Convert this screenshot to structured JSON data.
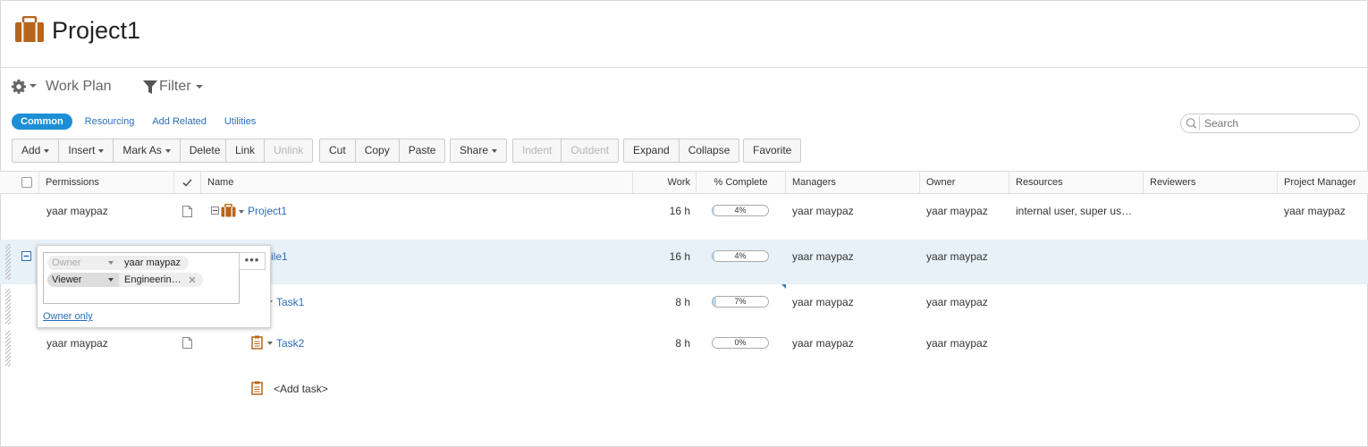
{
  "header": {
    "title": "Project1"
  },
  "workplan": {
    "title": "Work Plan",
    "filter_label": "Filter"
  },
  "tabs": [
    {
      "label": "Common",
      "active": true
    },
    {
      "label": "Resourcing"
    },
    {
      "label": "Add Related"
    },
    {
      "label": "Utilities"
    }
  ],
  "search": {
    "placeholder": "Search"
  },
  "toolbar": {
    "add": "Add",
    "insert": "Insert",
    "mark_as": "Mark As",
    "delete": "Delete",
    "link": "Link",
    "unlink": "Unlink",
    "cut": "Cut",
    "copy": "Copy",
    "paste": "Paste",
    "share": "Share",
    "indent": "Indent",
    "outdent": "Outdent",
    "expand": "Expand",
    "collapse": "Collapse",
    "favorite": "Favorite"
  },
  "columns": {
    "permissions": "Permissions",
    "name": "Name",
    "work": "Work",
    "pct": "% Complete",
    "managers": "Managers",
    "owner": "Owner",
    "resources": "Resources",
    "reviewers": "Reviewers",
    "project_manager": "Project Manager"
  },
  "rows": [
    {
      "permissions": "yaar maypaz",
      "name": "Project1",
      "work": "16 h",
      "pct": "4%",
      "pct_value": 4,
      "managers": "yaar maypaz",
      "owner": "yaar maypaz",
      "resources": "internal user, super us…",
      "project_manager": "yaar maypaz"
    },
    {
      "permissions": "",
      "name": "ile1",
      "work": "16 h",
      "pct": "4%",
      "pct_value": 4,
      "managers": "yaar maypaz",
      "owner": "yaar maypaz"
    },
    {
      "permissions": "",
      "name": "Task1",
      "work": "8 h",
      "pct": "7%",
      "pct_value": 7,
      "managers": "yaar maypaz",
      "owner": "yaar maypaz"
    },
    {
      "permissions": "yaar maypaz",
      "name": "Task2",
      "work": "8 h",
      "pct": "0%",
      "pct_value": 0,
      "managers": "yaar maypaz",
      "owner": "yaar maypaz"
    }
  ],
  "add_task": "<Add task>",
  "popup": {
    "owner_role": "Owner",
    "owner_value": "yaar maypaz",
    "viewer_role": "Viewer",
    "viewer_value": "Engineerin…",
    "dots": "•••",
    "owner_only": "Owner only"
  },
  "colors": {
    "accent": "#1c8fd6",
    "link": "#2a6ebb",
    "icon_brown": "#b5651d",
    "selected_row": "#e8f1f8"
  }
}
